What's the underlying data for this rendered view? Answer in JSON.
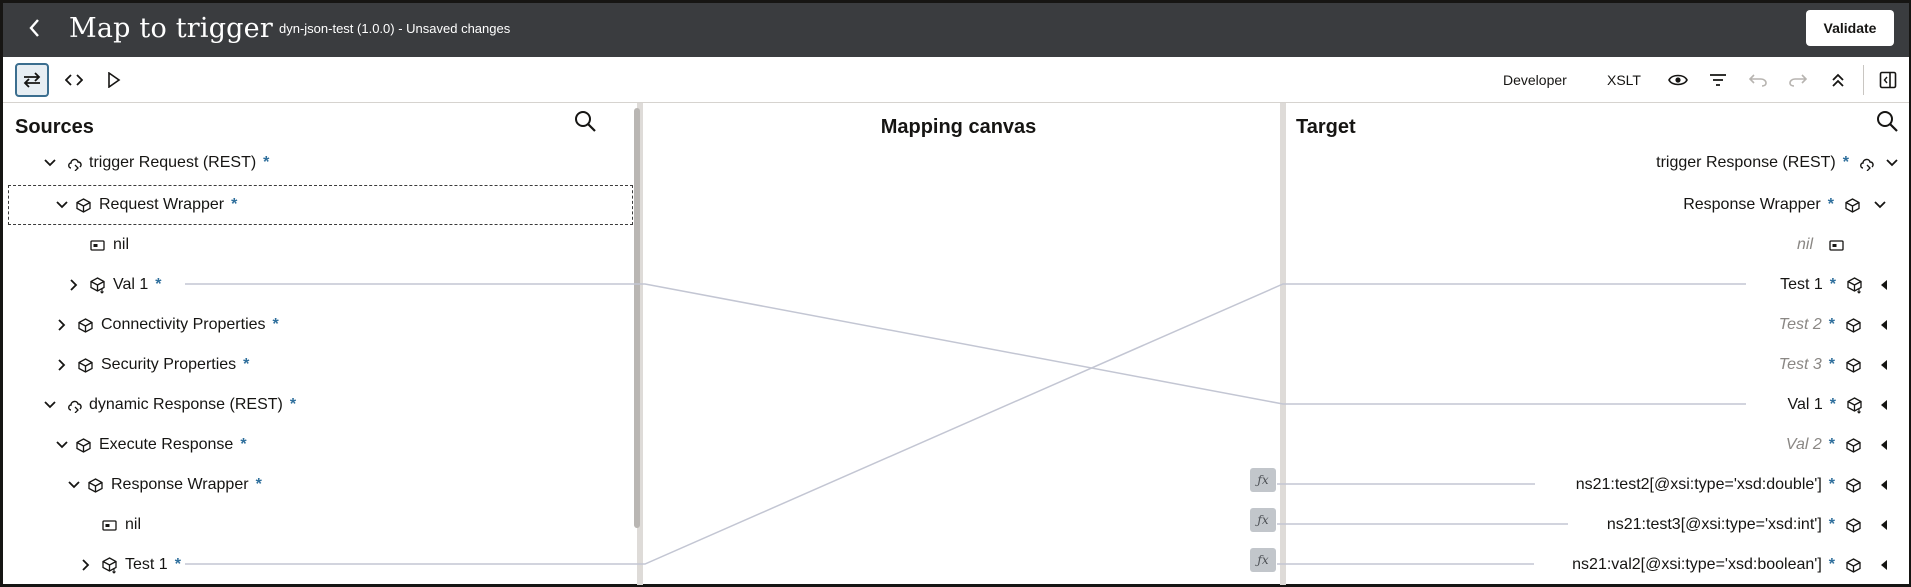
{
  "header": {
    "title": "Map to trigger",
    "subtitle": "dyn-json-test (1.0.0) - Unsaved changes",
    "validate_label": "Validate"
  },
  "toolbar": {
    "developer_label": "Developer",
    "xslt_label": "XSLT",
    "icons": [
      "swap-icon",
      "code-icon",
      "play-icon",
      "eye-icon",
      "filter-icon",
      "undo-icon",
      "redo-icon",
      "collapse-all-icon",
      "panel-toggle-icon"
    ]
  },
  "sources": {
    "title": "Sources",
    "rows": [
      {
        "label": "trigger Request (REST)",
        "required": "*"
      },
      {
        "label": "Request Wrapper",
        "required": "*"
      },
      {
        "label": "nil",
        "required": ""
      },
      {
        "label": "Val 1",
        "required": "*"
      },
      {
        "label": "Connectivity Properties",
        "required": "*"
      },
      {
        "label": "Security Properties",
        "required": "*"
      },
      {
        "label": "dynamic Response (REST)",
        "required": "*"
      },
      {
        "label": "Execute Response",
        "required": "*"
      },
      {
        "label": "Response Wrapper",
        "required": "*"
      },
      {
        "label": "nil",
        "required": ""
      },
      {
        "label": "Test 1",
        "required": "*"
      }
    ]
  },
  "canvas": {
    "title": "Mapping canvas",
    "fx_label": "ƒx"
  },
  "target": {
    "title": "Target",
    "rows": [
      {
        "label": "trigger Response (REST)",
        "required": "*"
      },
      {
        "label": "Response Wrapper",
        "required": "*"
      },
      {
        "label": "nil",
        "required": ""
      },
      {
        "label": "Test 1",
        "required": "*"
      },
      {
        "label": "Test 2",
        "required": "*"
      },
      {
        "label": "Test 3",
        "required": "*"
      },
      {
        "label": "Val 1",
        "required": "*"
      },
      {
        "label": "Val 2",
        "required": "*"
      },
      {
        "label": "ns21:test2[@xsi:type='xsd:double']",
        "required": "*"
      },
      {
        "label": "ns21:test3[@xsi:type='xsd:int']",
        "required": "*"
      },
      {
        "label": "ns21:val2[@xsi:type='xsd:boolean']",
        "required": "*"
      }
    ]
  },
  "colors": {
    "header_bg": "#3a3c3f",
    "required_star": "#2f6f9c",
    "link_line": "#c3c6d3",
    "fx_badge": "#c2c6cb"
  }
}
